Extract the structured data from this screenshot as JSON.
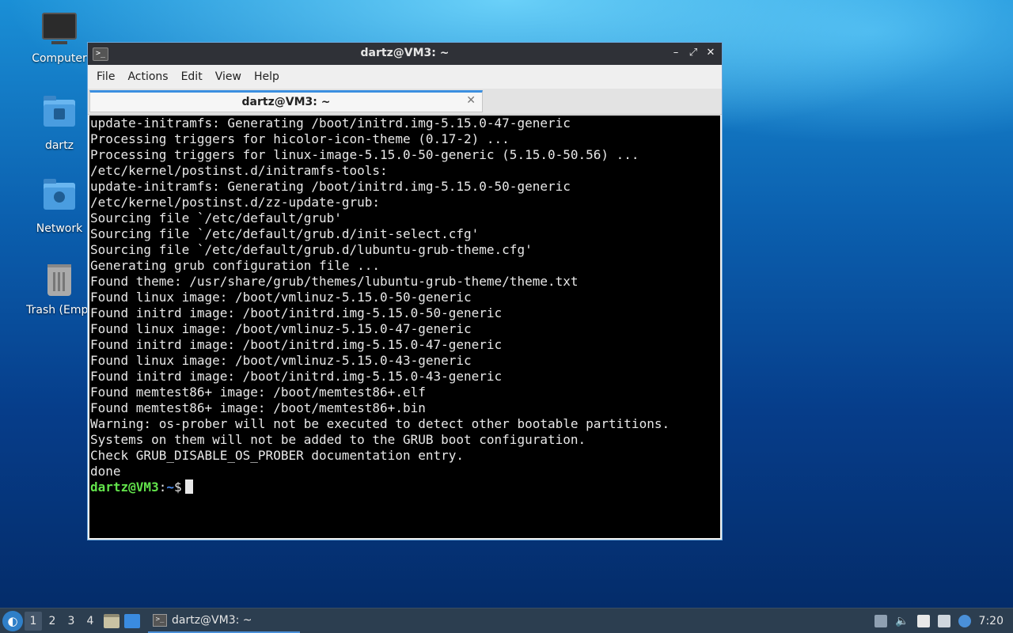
{
  "desktop": {
    "icons": [
      {
        "label": "Computer",
        "icon": "computer-icon"
      },
      {
        "label": "dartz",
        "icon": "home-folder-icon"
      },
      {
        "label": "Network",
        "icon": "network-folder-icon"
      },
      {
        "label": "Trash (Empt",
        "icon": "trash-icon"
      }
    ]
  },
  "window": {
    "title": "dartz@VM3: ~",
    "controls": {
      "minimize": "–",
      "maximize": "⤢",
      "close": "✕"
    },
    "menu": [
      "File",
      "Actions",
      "Edit",
      "View",
      "Help"
    ],
    "tab": {
      "title": "dartz@VM3: ~",
      "close": "✕"
    }
  },
  "terminal": {
    "lines": [
      "update-initramfs: Generating /boot/initrd.img-5.15.0-47-generic",
      "Processing triggers for hicolor-icon-theme (0.17-2) ...",
      "Processing triggers for linux-image-5.15.0-50-generic (5.15.0-50.56) ...",
      "/etc/kernel/postinst.d/initramfs-tools:",
      "update-initramfs: Generating /boot/initrd.img-5.15.0-50-generic",
      "/etc/kernel/postinst.d/zz-update-grub:",
      "Sourcing file `/etc/default/grub'",
      "Sourcing file `/etc/default/grub.d/init-select.cfg'",
      "Sourcing file `/etc/default/grub.d/lubuntu-grub-theme.cfg'",
      "Generating grub configuration file ...",
      "Found theme: /usr/share/grub/themes/lubuntu-grub-theme/theme.txt",
      "Found linux image: /boot/vmlinuz-5.15.0-50-generic",
      "Found initrd image: /boot/initrd.img-5.15.0-50-generic",
      "Found linux image: /boot/vmlinuz-5.15.0-47-generic",
      "Found initrd image: /boot/initrd.img-5.15.0-47-generic",
      "Found linux image: /boot/vmlinuz-5.15.0-43-generic",
      "Found initrd image: /boot/initrd.img-5.15.0-43-generic",
      "Found memtest86+ image: /boot/memtest86+.elf",
      "Found memtest86+ image: /boot/memtest86+.bin",
      "Warning: os-prober will not be executed to detect other bootable partitions.",
      "Systems on them will not be added to the GRUB boot configuration.",
      "Check GRUB_DISABLE_OS_PROBER documentation entry.",
      "done"
    ],
    "prompt": {
      "user": "dartz@VM3",
      "sep": ":",
      "path": "~",
      "symbol": "$"
    }
  },
  "taskbar": {
    "workspaces": [
      "1",
      "2",
      "3",
      "4"
    ],
    "active_workspace": "1",
    "task_title": "dartz@VM3: ~",
    "clock": "7:20"
  }
}
